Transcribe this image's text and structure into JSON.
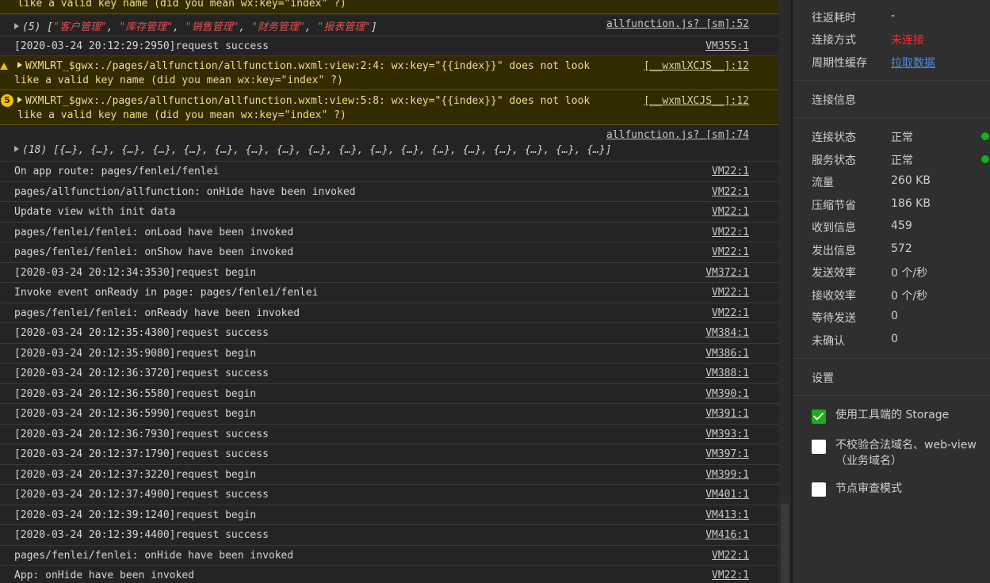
{
  "console": {
    "warn_top_tail": "like a valid key name (did you mean wx:key=\"index\" ?)",
    "array5": {
      "prefix": "(5) [",
      "items": [
        "\"客户管理\"",
        "\"库存管理\"",
        "\"销售管理\"",
        "\"财务管理\"",
        "\"报表管理\""
      ],
      "sep": ", ",
      "suffix": "]",
      "src": "allfunction.js? [sm]:52"
    },
    "row_success_1": {
      "msg": "[2020-03-24 20:12:29:2950]request success",
      "src": "VM355:1"
    },
    "warn1": {
      "line1": "WXMLRT_$gwx:./pages/allfunction/allfunction.wxml:view:2:4: wx:key=\"{{index}}\" does not look",
      "line2": "like a valid key name (did you mean wx:key=\"index\" ?)",
      "src": "[__wxmlXCJS__]:12"
    },
    "warn2": {
      "badge": "5",
      "line1": "WXMLRT_$gwx:./pages/allfunction/allfunction.wxml:view:5:8: wx:key=\"{{index}}\" does not look",
      "line2": "like a valid key name (did you mean wx:key=\"index\" ?)",
      "src": "[__wxmlXCJS__]:12"
    },
    "array18": {
      "src": "allfunction.js? [sm]:74",
      "text": "(18) [{…}, {…}, {…}, {…}, {…}, {…}, {…}, {…}, {…}, {…}, {…}, {…}, {…}, {…}, {…}, {…}, {…}, {…}]"
    },
    "rows": [
      {
        "msg": "On app route: pages/fenlei/fenlei",
        "src": "VM22:1"
      },
      {
        "msg": "pages/allfunction/allfunction: onHide have been invoked",
        "src": "VM22:1"
      },
      {
        "msg": "Update view with init data",
        "src": "VM22:1"
      },
      {
        "msg": "pages/fenlei/fenlei: onLoad have been invoked",
        "src": "VM22:1"
      },
      {
        "msg": "pages/fenlei/fenlei: onShow have been invoked",
        "src": "VM22:1"
      },
      {
        "msg": "[2020-03-24 20:12:34:3530]request begin",
        "src": "VM372:1"
      },
      {
        "msg": "Invoke event onReady in page: pages/fenlei/fenlei",
        "src": "VM22:1"
      },
      {
        "msg": "pages/fenlei/fenlei: onReady have been invoked",
        "src": "VM22:1"
      },
      {
        "msg": "[2020-03-24 20:12:35:4300]request success",
        "src": "VM384:1"
      },
      {
        "msg": "[2020-03-24 20:12:35:9080]request begin",
        "src": "VM386:1"
      },
      {
        "msg": "[2020-03-24 20:12:36:3720]request success",
        "src": "VM388:1"
      },
      {
        "msg": "[2020-03-24 20:12:36:5580]request begin",
        "src": "VM390:1"
      },
      {
        "msg": "[2020-03-24 20:12:36:5990]request begin",
        "src": "VM391:1"
      },
      {
        "msg": "[2020-03-24 20:12:36:7930]request success",
        "src": "VM393:1"
      },
      {
        "msg": "[2020-03-24 20:12:37:1790]request success",
        "src": "VM397:1"
      },
      {
        "msg": "[2020-03-24 20:12:37:3220]request begin",
        "src": "VM399:1"
      },
      {
        "msg": "[2020-03-24 20:12:37:4900]request success",
        "src": "VM401:1"
      },
      {
        "msg": "[2020-03-24 20:12:39:1240]request begin",
        "src": "VM413:1"
      },
      {
        "msg": "[2020-03-24 20:12:39:4400]request success",
        "src": "VM416:1"
      },
      {
        "msg": "pages/fenlei/fenlei: onHide have been invoked",
        "src": "VM22:1"
      },
      {
        "msg": "App: onHide have been invoked",
        "src": "VM22:1"
      }
    ]
  },
  "side": {
    "rows_top": [
      {
        "k": "往返耗时",
        "v": "-"
      },
      {
        "k": "连接方式",
        "v": "未连接"
      },
      {
        "k": "周期性缓存",
        "v": "拉取数据"
      }
    ],
    "conn_header": "连接信息",
    "conn_rows": [
      {
        "k": "连接状态",
        "v": "正常"
      },
      {
        "k": "服务状态",
        "v": "正常"
      },
      {
        "k": "流量",
        "v": "260 KB"
      },
      {
        "k": "压缩节省",
        "v": "186 KB"
      },
      {
        "k": "收到信息",
        "v": "459"
      },
      {
        "k": "发出信息",
        "v": "572"
      },
      {
        "k": "发送效率",
        "v": "0 个/秒"
      },
      {
        "k": "接收效率",
        "v": "0 个/秒"
      },
      {
        "k": "等待发送",
        "v": "0"
      },
      {
        "k": "未确认",
        "v": "0"
      }
    ],
    "settings_header": "设置",
    "settings": [
      {
        "label": "使用工具端的 Storage",
        "checked": true
      },
      {
        "label": "不校验合法域名、web-view（业务域名）",
        "checked": false
      },
      {
        "label": "节点审查模式",
        "checked": false
      }
    ],
    "colors": {
      "status_ok": "#1aad19",
      "disconnected": "#ff2a2a",
      "link": "#4a8fe0"
    }
  }
}
